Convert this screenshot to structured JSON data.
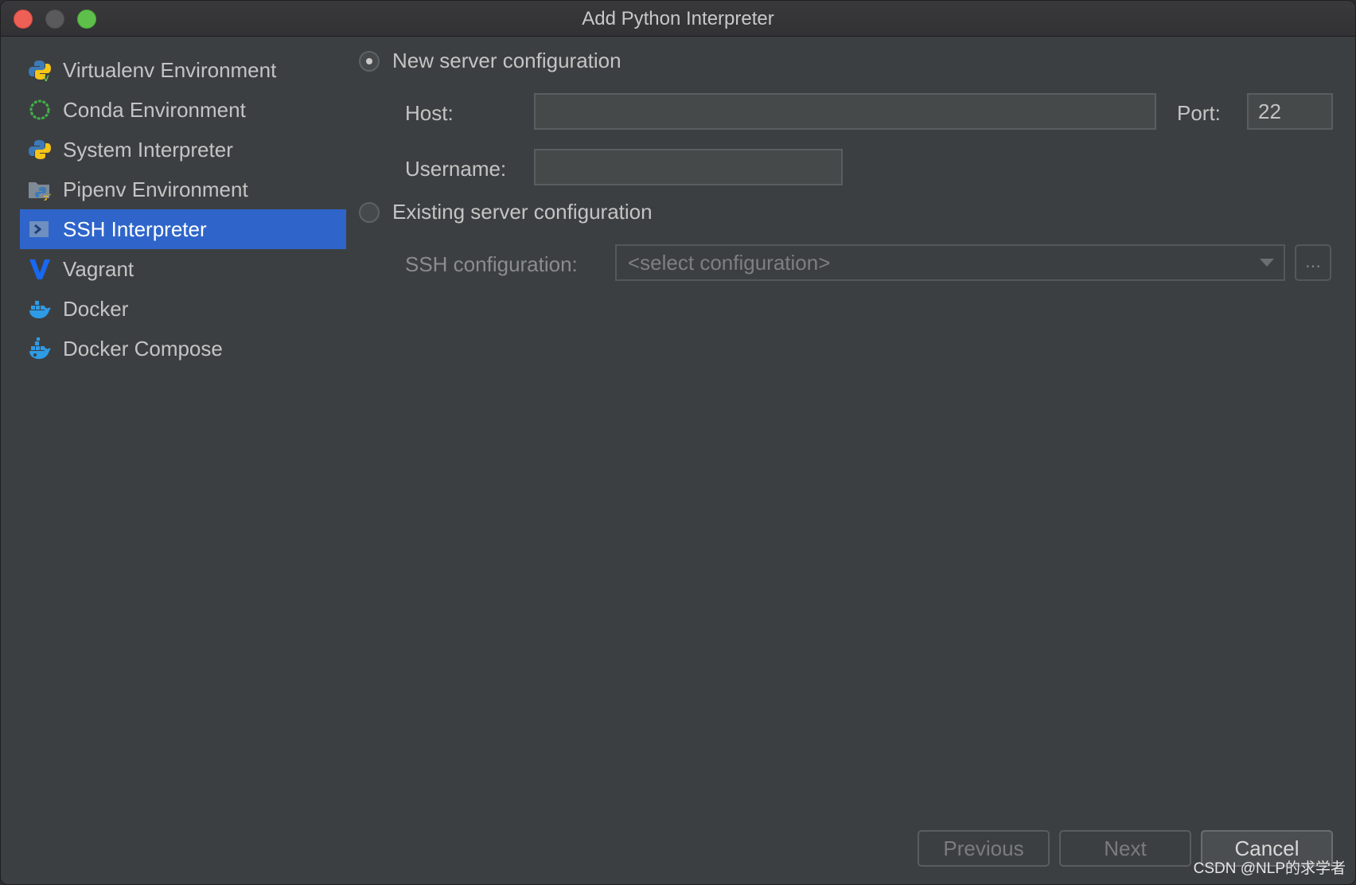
{
  "window": {
    "title": "Add Python Interpreter"
  },
  "sidebar": {
    "items": [
      {
        "label": "Virtualenv Environment",
        "icon": "python-virtualenv-icon"
      },
      {
        "label": "Conda Environment",
        "icon": "conda-icon"
      },
      {
        "label": "System Interpreter",
        "icon": "python-icon"
      },
      {
        "label": "Pipenv Environment",
        "icon": "pipenv-icon"
      },
      {
        "label": "SSH Interpreter",
        "icon": "ssh-icon",
        "selected": true
      },
      {
        "label": "Vagrant",
        "icon": "vagrant-icon"
      },
      {
        "label": "Docker",
        "icon": "docker-icon"
      },
      {
        "label": "Docker Compose",
        "icon": "docker-compose-icon"
      }
    ]
  },
  "form": {
    "new_server": {
      "label": "New server configuration",
      "selected": true
    },
    "host": {
      "label": "Host:",
      "value": ""
    },
    "port": {
      "label": "Port:",
      "value": "22"
    },
    "username": {
      "label": "Username:",
      "value": ""
    },
    "existing_server": {
      "label": "Existing server configuration",
      "selected": false
    },
    "ssh_config": {
      "label": "SSH configuration:",
      "placeholder": "<select configuration>",
      "browse_label": "..."
    }
  },
  "buttons": {
    "previous": "Previous",
    "next": "Next",
    "cancel": "Cancel"
  },
  "watermark": "CSDN @NLP的求学者",
  "colors": {
    "selection": "#2f65ca",
    "background": "#3c3f41"
  }
}
